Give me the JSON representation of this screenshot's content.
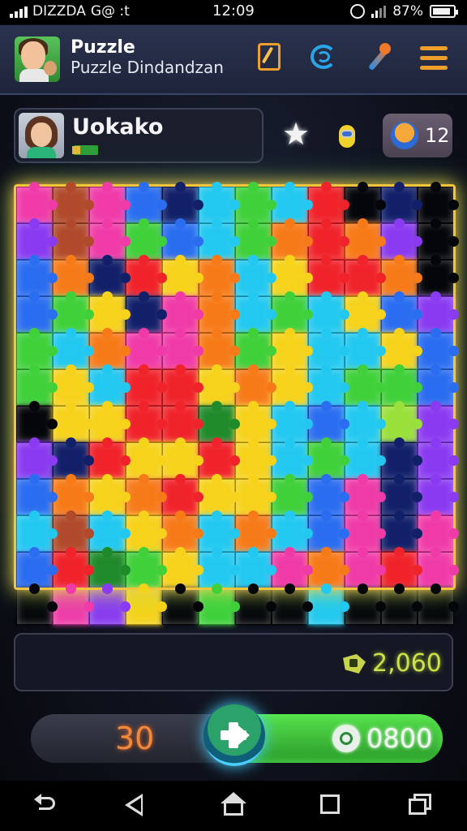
{
  "status_bar": {
    "carrier": "DIZZDA",
    "carrier_extra": "G@ :t",
    "time": "12:09",
    "battery_text": "87%",
    "battery_level": 0.87
  },
  "header": {
    "title": "Puzzle",
    "subtitle": "Puzzle Dindandzan",
    "icons": [
      "avatar",
      "edit-book-icon",
      "swirl-icon",
      "magic-wand-icon",
      "menu-icon"
    ]
  },
  "player": {
    "name": "Uokako",
    "coin_count": "12"
  },
  "board": {
    "columns": 12,
    "rows": 12,
    "colors": {
      "R": "#f0222a",
      "O": "#f77a18",
      "Y": "#f6d21a",
      "G": "#3fd03a",
      "DG": "#1f8a2a",
      "C": "#22c8f0",
      "B": "#2a6df0",
      "DB": "#12206a",
      "P": "#8a3af0",
      "M": "#f03aa8",
      "K": "#05060a",
      "BR": "#b04a2a",
      "LG": "#9ae03a",
      "T": "#1fb4b0"
    },
    "grid": [
      [
        "M",
        "BR",
        "M",
        "B",
        "DB",
        "C",
        "G",
        "C",
        "R",
        "K",
        "DB",
        "K"
      ],
      [
        "P",
        "BR",
        "M",
        "G",
        "B",
        "C",
        "G",
        "O",
        "R",
        "O",
        "P",
        "K"
      ],
      [
        "B",
        "O",
        "DB",
        "R",
        "Y",
        "O",
        "C",
        "Y",
        "R",
        "R",
        "O",
        "K"
      ],
      [
        "B",
        "G",
        "Y",
        "DB",
        "M",
        "O",
        "C",
        "G",
        "C",
        "Y",
        "B",
        "P"
      ],
      [
        "G",
        "C",
        "O",
        "M",
        "M",
        "O",
        "G",
        "Y",
        "C",
        "C",
        "Y",
        "B"
      ],
      [
        "G",
        "Y",
        "C",
        "R",
        "R",
        "Y",
        "O",
        "Y",
        "C",
        "G",
        "G",
        "B"
      ],
      [
        "K",
        "Y",
        "Y",
        "R",
        "R",
        "DG",
        "Y",
        "C",
        "B",
        "C",
        "LG",
        "P"
      ],
      [
        "P",
        "DB",
        "R",
        "Y",
        "Y",
        "R",
        "Y",
        "C",
        "G",
        "C",
        "DB",
        "P"
      ],
      [
        "B",
        "O",
        "Y",
        "O",
        "R",
        "Y",
        "Y",
        "G",
        "B",
        "M",
        "DB",
        "P"
      ],
      [
        "C",
        "BR",
        "C",
        "Y",
        "O",
        "C",
        "O",
        "C",
        "B",
        "M",
        "DB",
        "M"
      ],
      [
        "B",
        "R",
        "DG",
        "G",
        "Y",
        "C",
        "C",
        "M",
        "O",
        "M",
        "R",
        "M"
      ],
      [
        "K",
        "M",
        "P",
        "Y",
        "K",
        "G",
        "K",
        "K",
        "C",
        "K",
        "K",
        "K"
      ]
    ]
  },
  "score": {
    "value": "2,060"
  },
  "play_bar": {
    "moves": "30",
    "gems": "0800",
    "button_label": "play"
  },
  "nav": [
    "back",
    "triangle-back",
    "home",
    "overview",
    "recent-apps"
  ]
}
